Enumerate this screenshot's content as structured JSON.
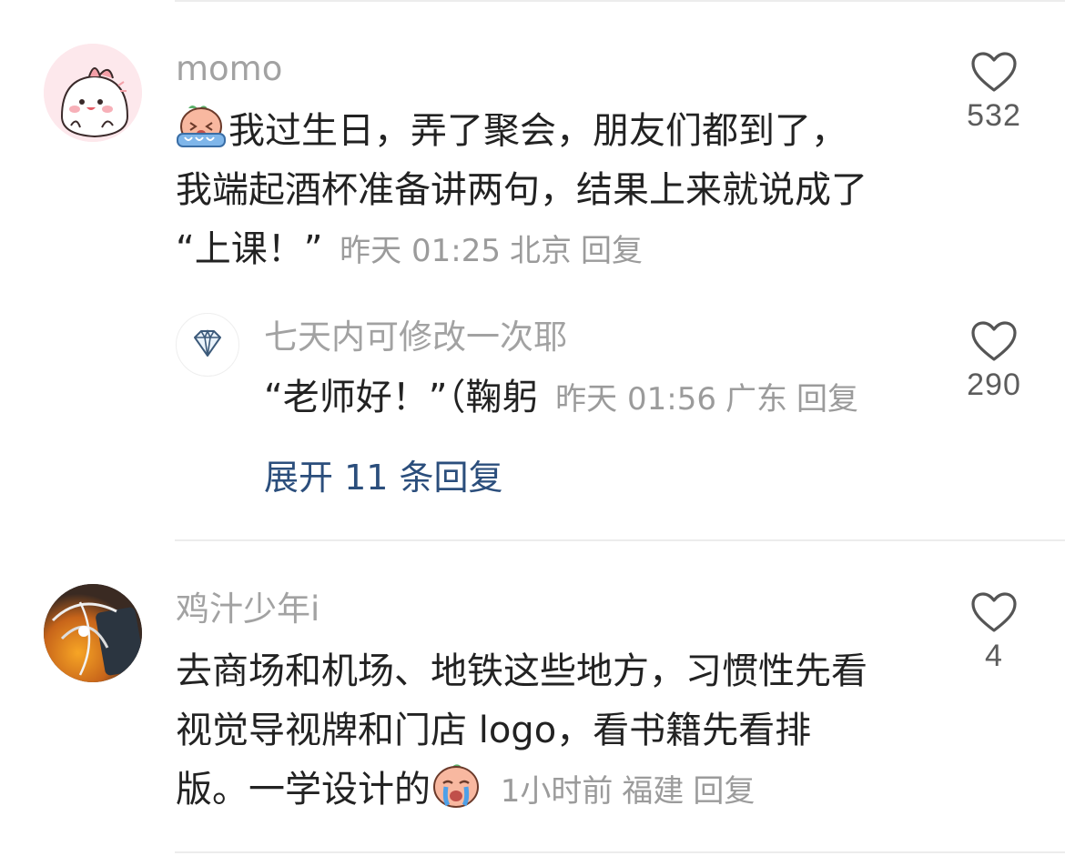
{
  "comments": [
    {
      "username": "momo",
      "avatar_icon": "cute-pink-character-avatar",
      "emoji": "crying-peach-emoji",
      "lines": [
        "我过生日，弄了聚会，朋友们都到了，",
        "我端起酒杯准备讲两句，结果上来就说成了",
        "“上课！”"
      ],
      "time": "昨天 01:25",
      "location": "北京",
      "reply_label": "回复",
      "likes": "532",
      "replies": [
        {
          "username": "七天内可修改一次耶",
          "avatar_icon": "diamond-icon",
          "text": "“老师好！”（鞠躬",
          "time": "昨天 01:56",
          "location": "广东",
          "reply_label": "回复",
          "likes": "290"
        }
      ],
      "expand_label": "展开 11 条回复"
    },
    {
      "username": "鸡汁少年i",
      "avatar_icon": "photo-avatar",
      "lines": [
        "去商场和机场、地铁这些地方，习惯性先看",
        "视觉导视牌和门店 logo，看书籍先看排",
        "版。一学设计的"
      ],
      "emoji": "crying-peach-emoji",
      "time": "1小时前",
      "location": "福建",
      "reply_label": "回复",
      "likes": "4"
    }
  ],
  "colors": {
    "username": "#a2a2a2",
    "text": "#222222",
    "meta": "#9b9b9b",
    "link": "#2b4e7c",
    "divider": "#ececec"
  }
}
